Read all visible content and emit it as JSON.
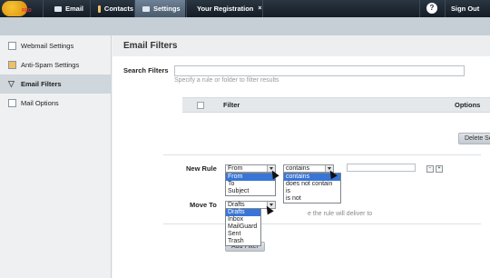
{
  "nav": {
    "logo_text": "RED",
    "tabs": [
      {
        "label": "Email",
        "icon": "envelope-icon"
      },
      {
        "label": "Contacts",
        "icon": "contacts-icon"
      },
      {
        "label": "Settings",
        "icon": "settings-icon"
      },
      {
        "label": "Your Registration",
        "icon": ""
      }
    ],
    "close_label": "×",
    "help_label": "?",
    "signout_label": "Sign Out"
  },
  "sidebar": {
    "items": [
      {
        "label": "Webmail Settings",
        "icon": "webmail-settings-icon"
      },
      {
        "label": "Anti-Spam Settings",
        "icon": "antispam-icon"
      },
      {
        "label": "Email Filters",
        "icon": "filter-icon"
      },
      {
        "label": "Mail Options",
        "icon": "mail-options-icon"
      }
    ]
  },
  "main": {
    "title": "Email Filters",
    "search": {
      "label": "Search Filters",
      "value": "",
      "hint": "Specify a rule or folder to filter results"
    },
    "table": {
      "col_filter": "Filter",
      "col_options": "Options"
    },
    "delete_label": "Delete Se",
    "new_rule": {
      "label": "New Rule",
      "field_selected": "From",
      "field_options": [
        "From",
        "To",
        "Subject"
      ],
      "op_selected": "contains",
      "op_options": [
        "contains",
        "does not contain",
        "is",
        "is not"
      ],
      "minus": "−",
      "plus": "+"
    },
    "move_to": {
      "label": "Move To",
      "selected": "Drafts",
      "options": [
        "Drafts",
        "Inbox",
        "MailGuard",
        "Sent",
        "Trash"
      ],
      "hint": "e the rule will deliver to"
    },
    "add_filter_label": "Add Filter"
  }
}
